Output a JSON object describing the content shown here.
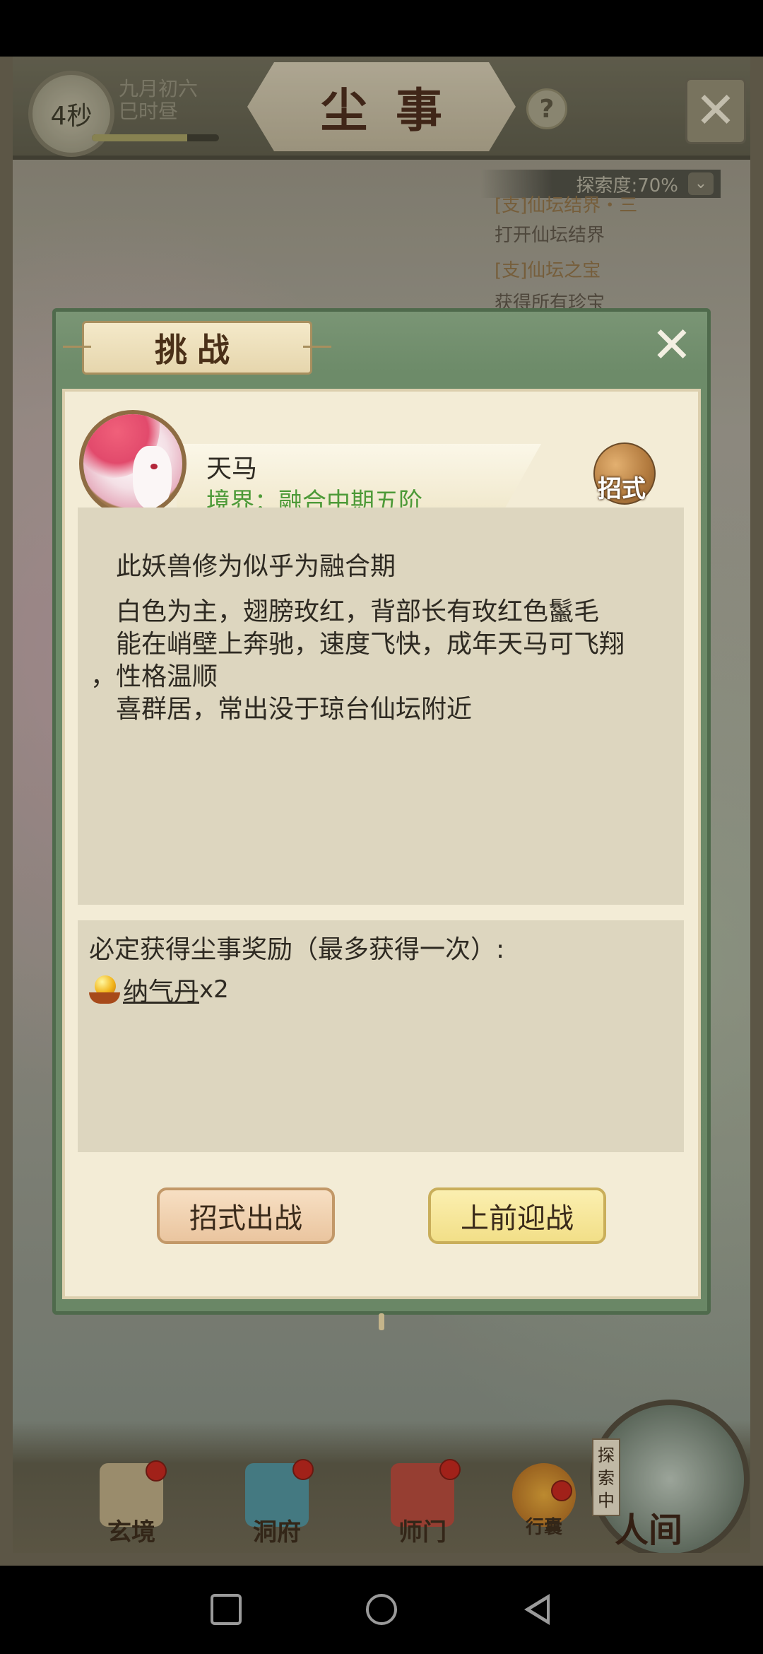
{
  "hud": {
    "timer": "4秒",
    "date_line1": "九月初六",
    "date_line2": "巳时昼",
    "time_progress": 0.75,
    "title": "尘事",
    "help_label": "?",
    "close_label": "✕"
  },
  "quest_tracker": {
    "progress": "探索度:70%",
    "expand_label": "⌄",
    "items": [
      {
        "title": "[支]仙坛结界・三",
        "desc": "打开仙坛结界"
      },
      {
        "title": "[支]仙坛之宝",
        "desc": "获得所有珍宝"
      }
    ]
  },
  "dialog": {
    "title": "挑战",
    "close_label": "✕",
    "monster": {
      "name": "天马",
      "realm": "境界：融合中期五阶"
    },
    "moves_button": "招式",
    "description": [
      "此妖兽修为似乎为融合期",
      "白色为主，翅膀玫红，背部长有玫红色鬣毛",
      "能在峭壁上奔驰，速度飞快，成年天马可飞翔",
      "，性格温顺",
      "喜群居，常出没于琼台仙坛附近"
    ],
    "reward_title": "必定获得尘事奖励（最多获得一次）:",
    "reward": {
      "name": "纳气丹",
      "qty": "x2"
    },
    "buttons": {
      "moves": "招式出战",
      "fight": "上前迎战"
    }
  },
  "bottom_nav": {
    "items": [
      {
        "label": "玄境"
      },
      {
        "label": "洞府"
      },
      {
        "label": "师门"
      },
      {
        "label": "行囊"
      }
    ],
    "explore_tag": "探索中",
    "world_label": "人间"
  },
  "colors": {
    "dialog_green": "#6d8b69",
    "paper": "#f3ecd6",
    "realm_text": "#4d9a38",
    "notification_red": "#c0241c"
  }
}
